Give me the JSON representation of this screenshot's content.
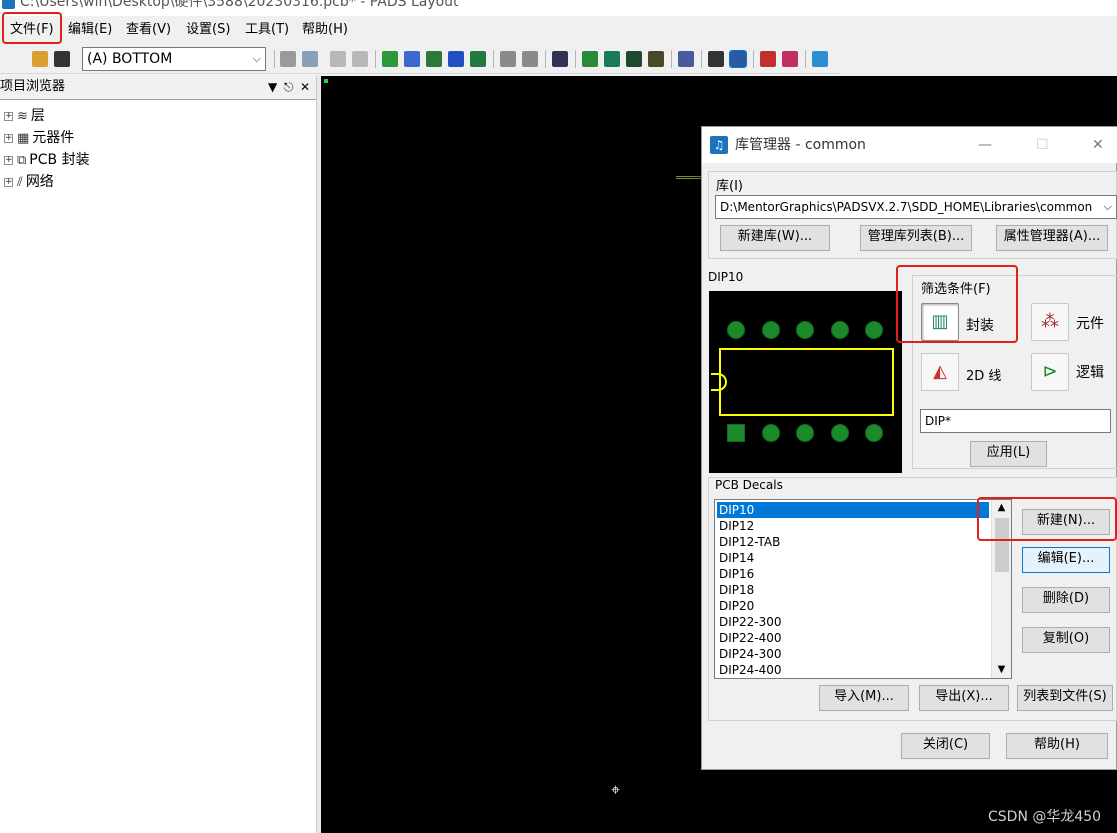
{
  "window": {
    "title": "C:\\Users\\win\\Desktop\\硬件\\3588\\20230316.pcb* - PADS Layout"
  },
  "menu": {
    "file": "文件(F)",
    "edit": "编辑(E)",
    "view": "查看(V)",
    "setup": "设置(S)",
    "tools": "工具(T)",
    "help": "帮助(H)"
  },
  "toolbar": {
    "layer": "(A) BOTTOM"
  },
  "project_browser": {
    "title": "项目浏览器",
    "items": [
      "层",
      "元器件",
      "PCB 封装",
      "网络"
    ]
  },
  "library_manager": {
    "title": "库管理器 - common",
    "library_label": "库(I)",
    "library_path": "D:\\MentorGraphics\\PADSVX.2.7\\SDD_HOME\\Libraries\\common",
    "new_library": "新建库(W)...",
    "manage_list": "管理库列表(B)...",
    "attr_manager": "属性管理器(A)...",
    "preview_name": "DIP10",
    "filter_label": "筛选条件(F)",
    "filter_decal": "封装",
    "filter_part": "元件",
    "filter_2d": "2D 线",
    "filter_logic": "逻辑",
    "filter_text": "DIP*",
    "apply": "应用(L)",
    "list_label": "PCB Decals",
    "decals": [
      "DIP10",
      "DIP12",
      "DIP12-TAB",
      "DIP14",
      "DIP16",
      "DIP18",
      "DIP20",
      "DIP22-300",
      "DIP22-400",
      "DIP24-300",
      "DIP24-400"
    ],
    "btn_new": "新建(N)...",
    "btn_edit": "编辑(E)...",
    "btn_delete": "删除(D)",
    "btn_copy": "复制(O)",
    "btn_import": "导入(M)...",
    "btn_export": "导出(X)...",
    "btn_list_to_file": "列表到文件(S)",
    "btn_close": "关闭(C)",
    "btn_help": "帮助(H)"
  },
  "watermark": "CSDN @华龙450",
  "colors": {
    "highlight_red": "#e0201c",
    "selection_blue": "#0078d7",
    "pad_green": "#1a8a2a",
    "outline_yellow": "#ffff00"
  }
}
